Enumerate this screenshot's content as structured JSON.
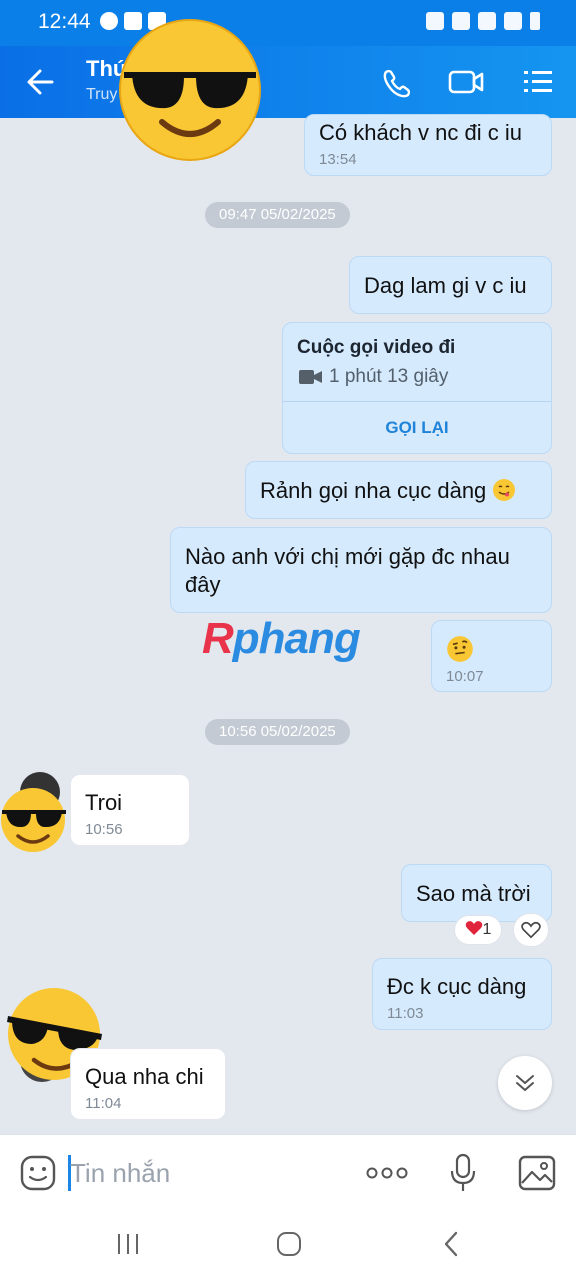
{
  "status_bar": {
    "time": "12:44"
  },
  "header": {
    "contact_name": "Thú",
    "contact_status": "Truy"
  },
  "messages": [
    {
      "dir": "out",
      "text": "Có khách v nc đi c iu",
      "time": "13:54"
    },
    {
      "type": "date",
      "text": "09:47 05/02/2025"
    },
    {
      "dir": "out",
      "text": "Dag lam gi v c iu"
    },
    {
      "type": "call",
      "title": "Cuộc gọi video đi",
      "duration": "1 phút 13 giây",
      "action": "GỌI LẠI"
    },
    {
      "dir": "out",
      "text": "Rảnh gọi nha cục dàng",
      "emoji": "savoring-face"
    },
    {
      "dir": "out",
      "text": "Nào anh với chị mới gặp đc nhau đây"
    },
    {
      "dir": "out",
      "emoji": "raised-eyebrow-face",
      "time": "10:07"
    },
    {
      "type": "date",
      "text": "10:56 05/02/2025"
    },
    {
      "dir": "in",
      "text": "Troi",
      "time": "10:56"
    },
    {
      "dir": "out",
      "text": "Sao mà trời",
      "reaction": {
        "emoji": "heart",
        "count": "1"
      }
    },
    {
      "dir": "out",
      "text": "Đc k cục dàng",
      "time": "11:03"
    },
    {
      "dir": "in",
      "text": "Qua nha chi",
      "time": "11:04"
    }
  ],
  "watermark": {
    "first": "R",
    "rest": "phang"
  },
  "input": {
    "placeholder": "Tin nhắn"
  },
  "colors": {
    "accent": "#0a7fe8",
    "bubble_out": "#d5eafd",
    "bubble_in": "#ffffff",
    "background": "#e3e8ef"
  }
}
